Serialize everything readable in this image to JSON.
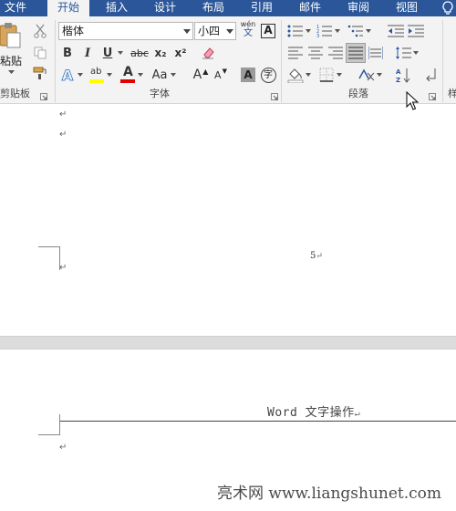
{
  "tabs": [
    {
      "key": "file",
      "label": "文件"
    },
    {
      "key": "home",
      "label": "开始"
    },
    {
      "key": "insert",
      "label": "插入"
    },
    {
      "key": "design",
      "label": "设计"
    },
    {
      "key": "layout",
      "label": "布局"
    },
    {
      "key": "references",
      "label": "引用"
    },
    {
      "key": "mailings",
      "label": "邮件"
    },
    {
      "key": "review",
      "label": "审阅"
    },
    {
      "key": "view",
      "label": "视图"
    }
  ],
  "clipboard": {
    "paste_label": "粘贴",
    "group_label": "剪贴板"
  },
  "font": {
    "name": "楷体",
    "size": "小四",
    "group_label": "字体",
    "phonetic_top": "wén",
    "phonetic_bottom": "文",
    "bold": "B",
    "italic": "I",
    "underline": "U",
    "strike": "abc",
    "subscript": "x₂",
    "superscript": "x²",
    "text_effect": "A",
    "highlight": "ab",
    "font_color": "A",
    "change_case": "Aa",
    "grow_font": "A",
    "shrink_font": "A",
    "char_shading": "A",
    "enclose": "字",
    "border_char": "A"
  },
  "paragraph": {
    "group_label": "段落",
    "next_group_initial": "样"
  },
  "colors": {
    "tabbar": "#2b579a",
    "highlight": "#ffff00",
    "font_color": "#e00000",
    "text_effect": "#4a86c8"
  },
  "document": {
    "page_number": "5",
    "header_text": "Word 文字操作",
    "paragraph_mark": "↵",
    "watermark": "亮术网 www.liangshunet.com"
  }
}
